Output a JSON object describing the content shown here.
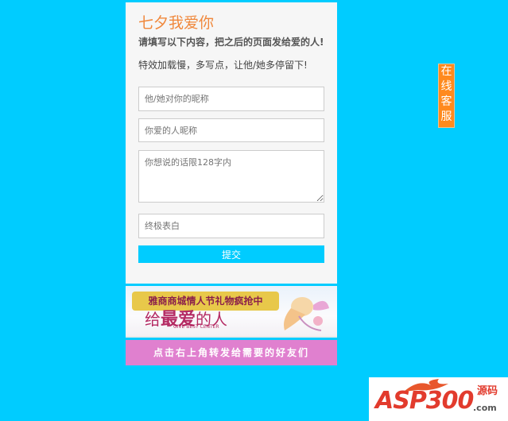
{
  "form": {
    "title": "七夕我爱你",
    "instruction": "请填写以下内容，把之后的页面发给爱的人!",
    "note": "特效加载慢，多写点，让他/她多停留下!",
    "nickname_placeholder": "他/她对你的昵称",
    "lover_placeholder": "你爱的人昵称",
    "message_placeholder": "你想说的话限128字内",
    "final_placeholder": "终极表白",
    "submit_label": "提交"
  },
  "banner_ad": {
    "top_text": "雅商商城情人节礼物疯抢中",
    "main_text_1": "给",
    "main_text_2": "最爱",
    "main_text_3": "的人",
    "small_text": "GIVE BEST CENTER"
  },
  "share_banner": {
    "text": "点击右上角转发给需要的好友们"
  },
  "side_tab": {
    "chars": [
      "在",
      "线",
      "客",
      "服"
    ]
  },
  "logo": {
    "brand": "ASP300",
    "cn": "源码",
    "domain": ".com"
  },
  "colors": {
    "background": "#00ccff",
    "title": "#f0883c",
    "accent": "#ff8a1e",
    "share_banner": "#e080cf"
  }
}
